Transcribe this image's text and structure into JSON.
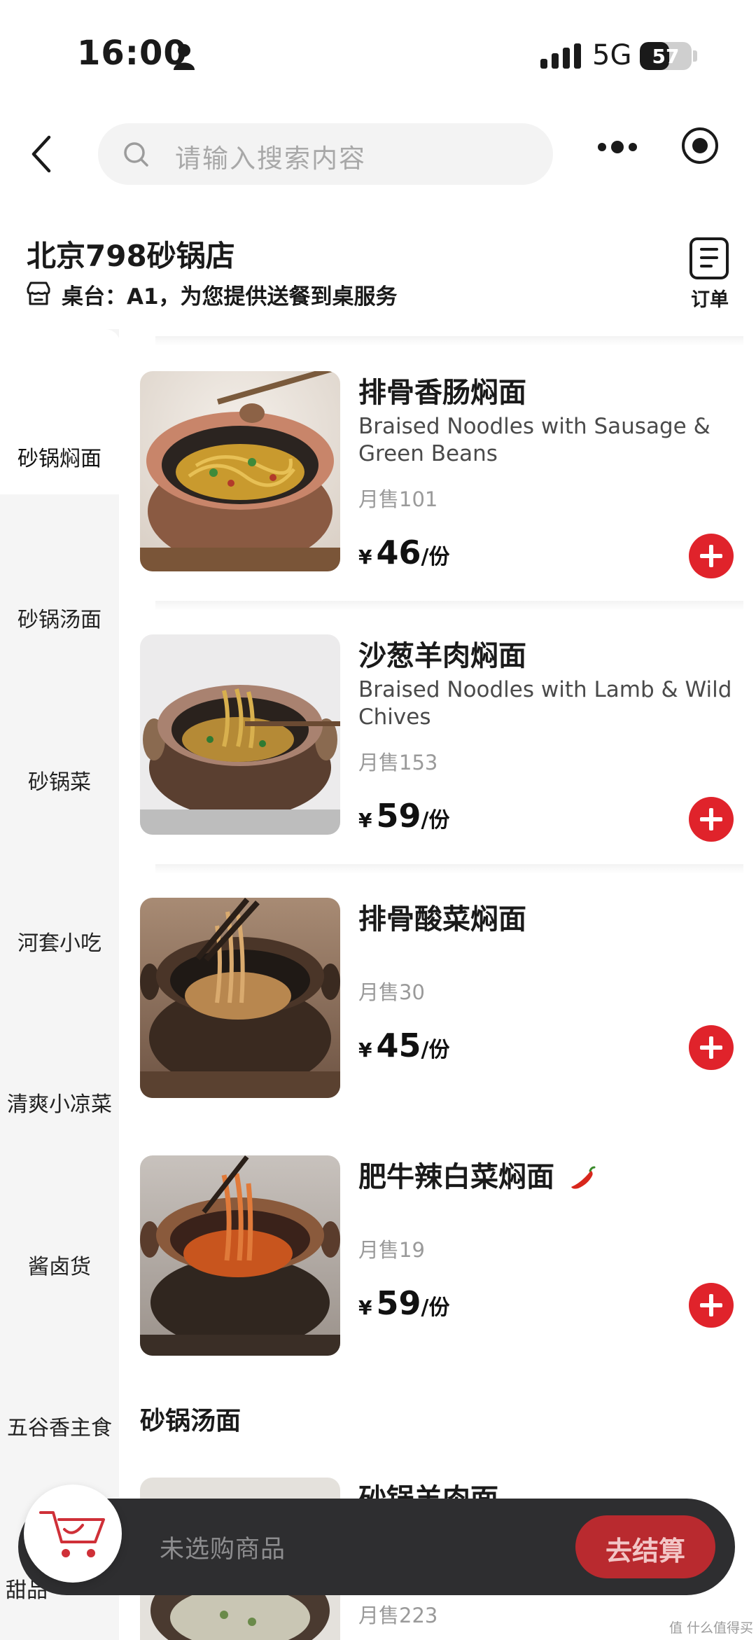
{
  "status": {
    "time": "16:00",
    "network": "5G",
    "battery": "57",
    "battery_level": 0.57
  },
  "nav": {
    "search_placeholder": "请输入搜索内容"
  },
  "shop": {
    "name": "北京798砂锅店",
    "table_info": "桌台：A1，为您提供送餐到桌服务",
    "order_label": "订单"
  },
  "sidebar": {
    "categories": [
      "砂锅焖面",
      "砂锅汤面",
      "砂锅菜",
      "河套小吃",
      "清爽小凉菜",
      "酱卤货",
      "五谷香主食",
      "甜品"
    ],
    "active_index": 0
  },
  "items": [
    {
      "name": "排骨香肠焖面",
      "name_en": "Braised Noodles with Sausage & Green Beans",
      "sales": "月售101",
      "currency": "¥",
      "price": "46",
      "unit": "/份"
    },
    {
      "name": "沙葱羊肉焖面",
      "name_en": "Braised Noodles with Lamb & Wild Chives",
      "sales": "月售153",
      "currency": "¥",
      "price": "59",
      "unit": "/份"
    },
    {
      "name": "排骨酸菜焖面",
      "sales": "月售30",
      "currency": "¥",
      "price": "45",
      "unit": "/份"
    },
    {
      "name": "肥牛辣白菜焖面",
      "sales": "月售19",
      "currency": "¥",
      "price": "59",
      "unit": "/份",
      "spicy_icon": "chili-pepper-icon"
    }
  ],
  "section2": {
    "title": "砂锅汤面",
    "item_name": "砂锅羊肉面",
    "item_sales": "月售223"
  },
  "cart": {
    "empty_text": "未选购商品",
    "checkout_label": "去结算"
  },
  "watermark": "值 什么值得买",
  "colors": {
    "accent_red": "#e0232b",
    "cart_bar": "#2e2e30",
    "checkout": "#b92a2f"
  }
}
